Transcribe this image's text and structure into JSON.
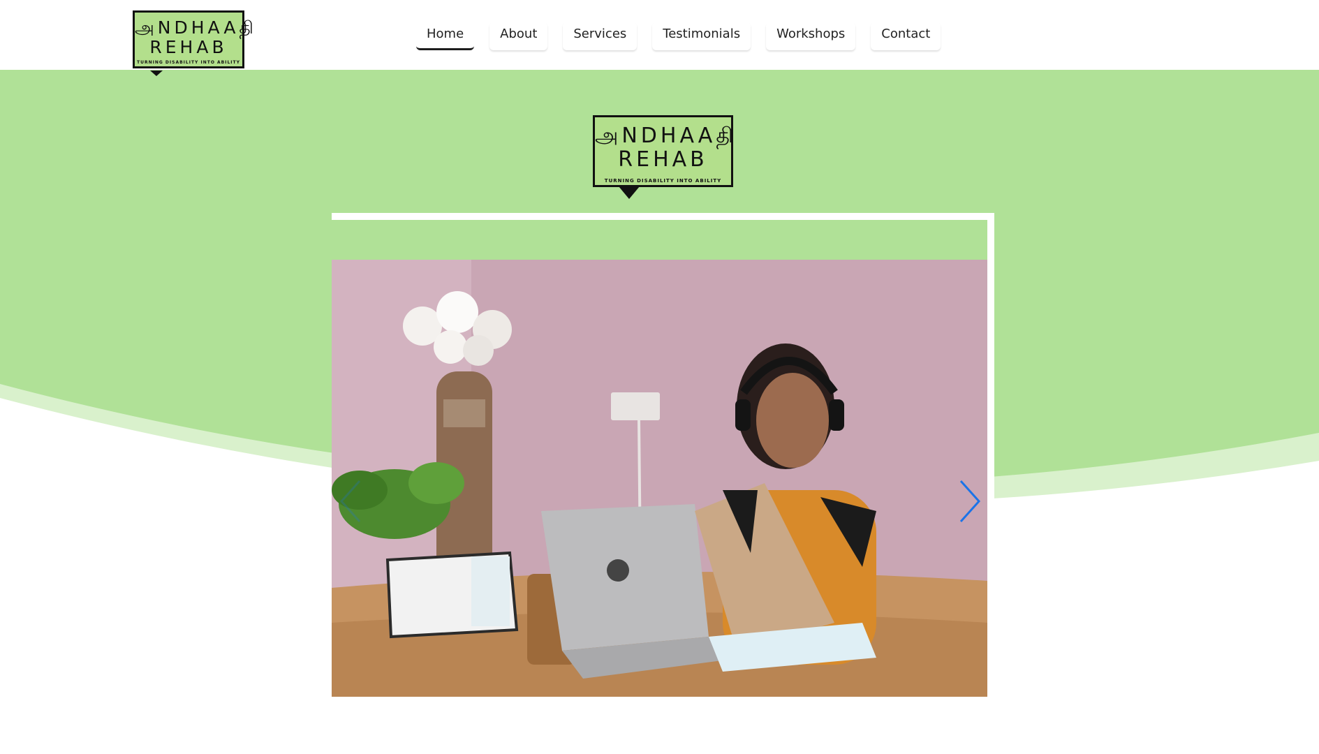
{
  "brand": {
    "line1": "அNDHAAதி",
    "line2": "REHAB",
    "tagline": "TURNING DISABILITY INTO ABILITY",
    "color": "#b3df8c"
  },
  "nav": {
    "items": [
      {
        "label": "Home",
        "active": true
      },
      {
        "label": "About"
      },
      {
        "label": "Services"
      },
      {
        "label": "Testimonials"
      },
      {
        "label": "Workshops"
      },
      {
        "label": "Contact"
      }
    ]
  },
  "slider": {
    "next_icon": "chevron-right-icon",
    "prev_icon": "chevron-left-icon",
    "accent": "#1a73e8"
  },
  "theme": {
    "hero_green": "#b0e197",
    "hero_green_light": "#d9f1cc"
  }
}
